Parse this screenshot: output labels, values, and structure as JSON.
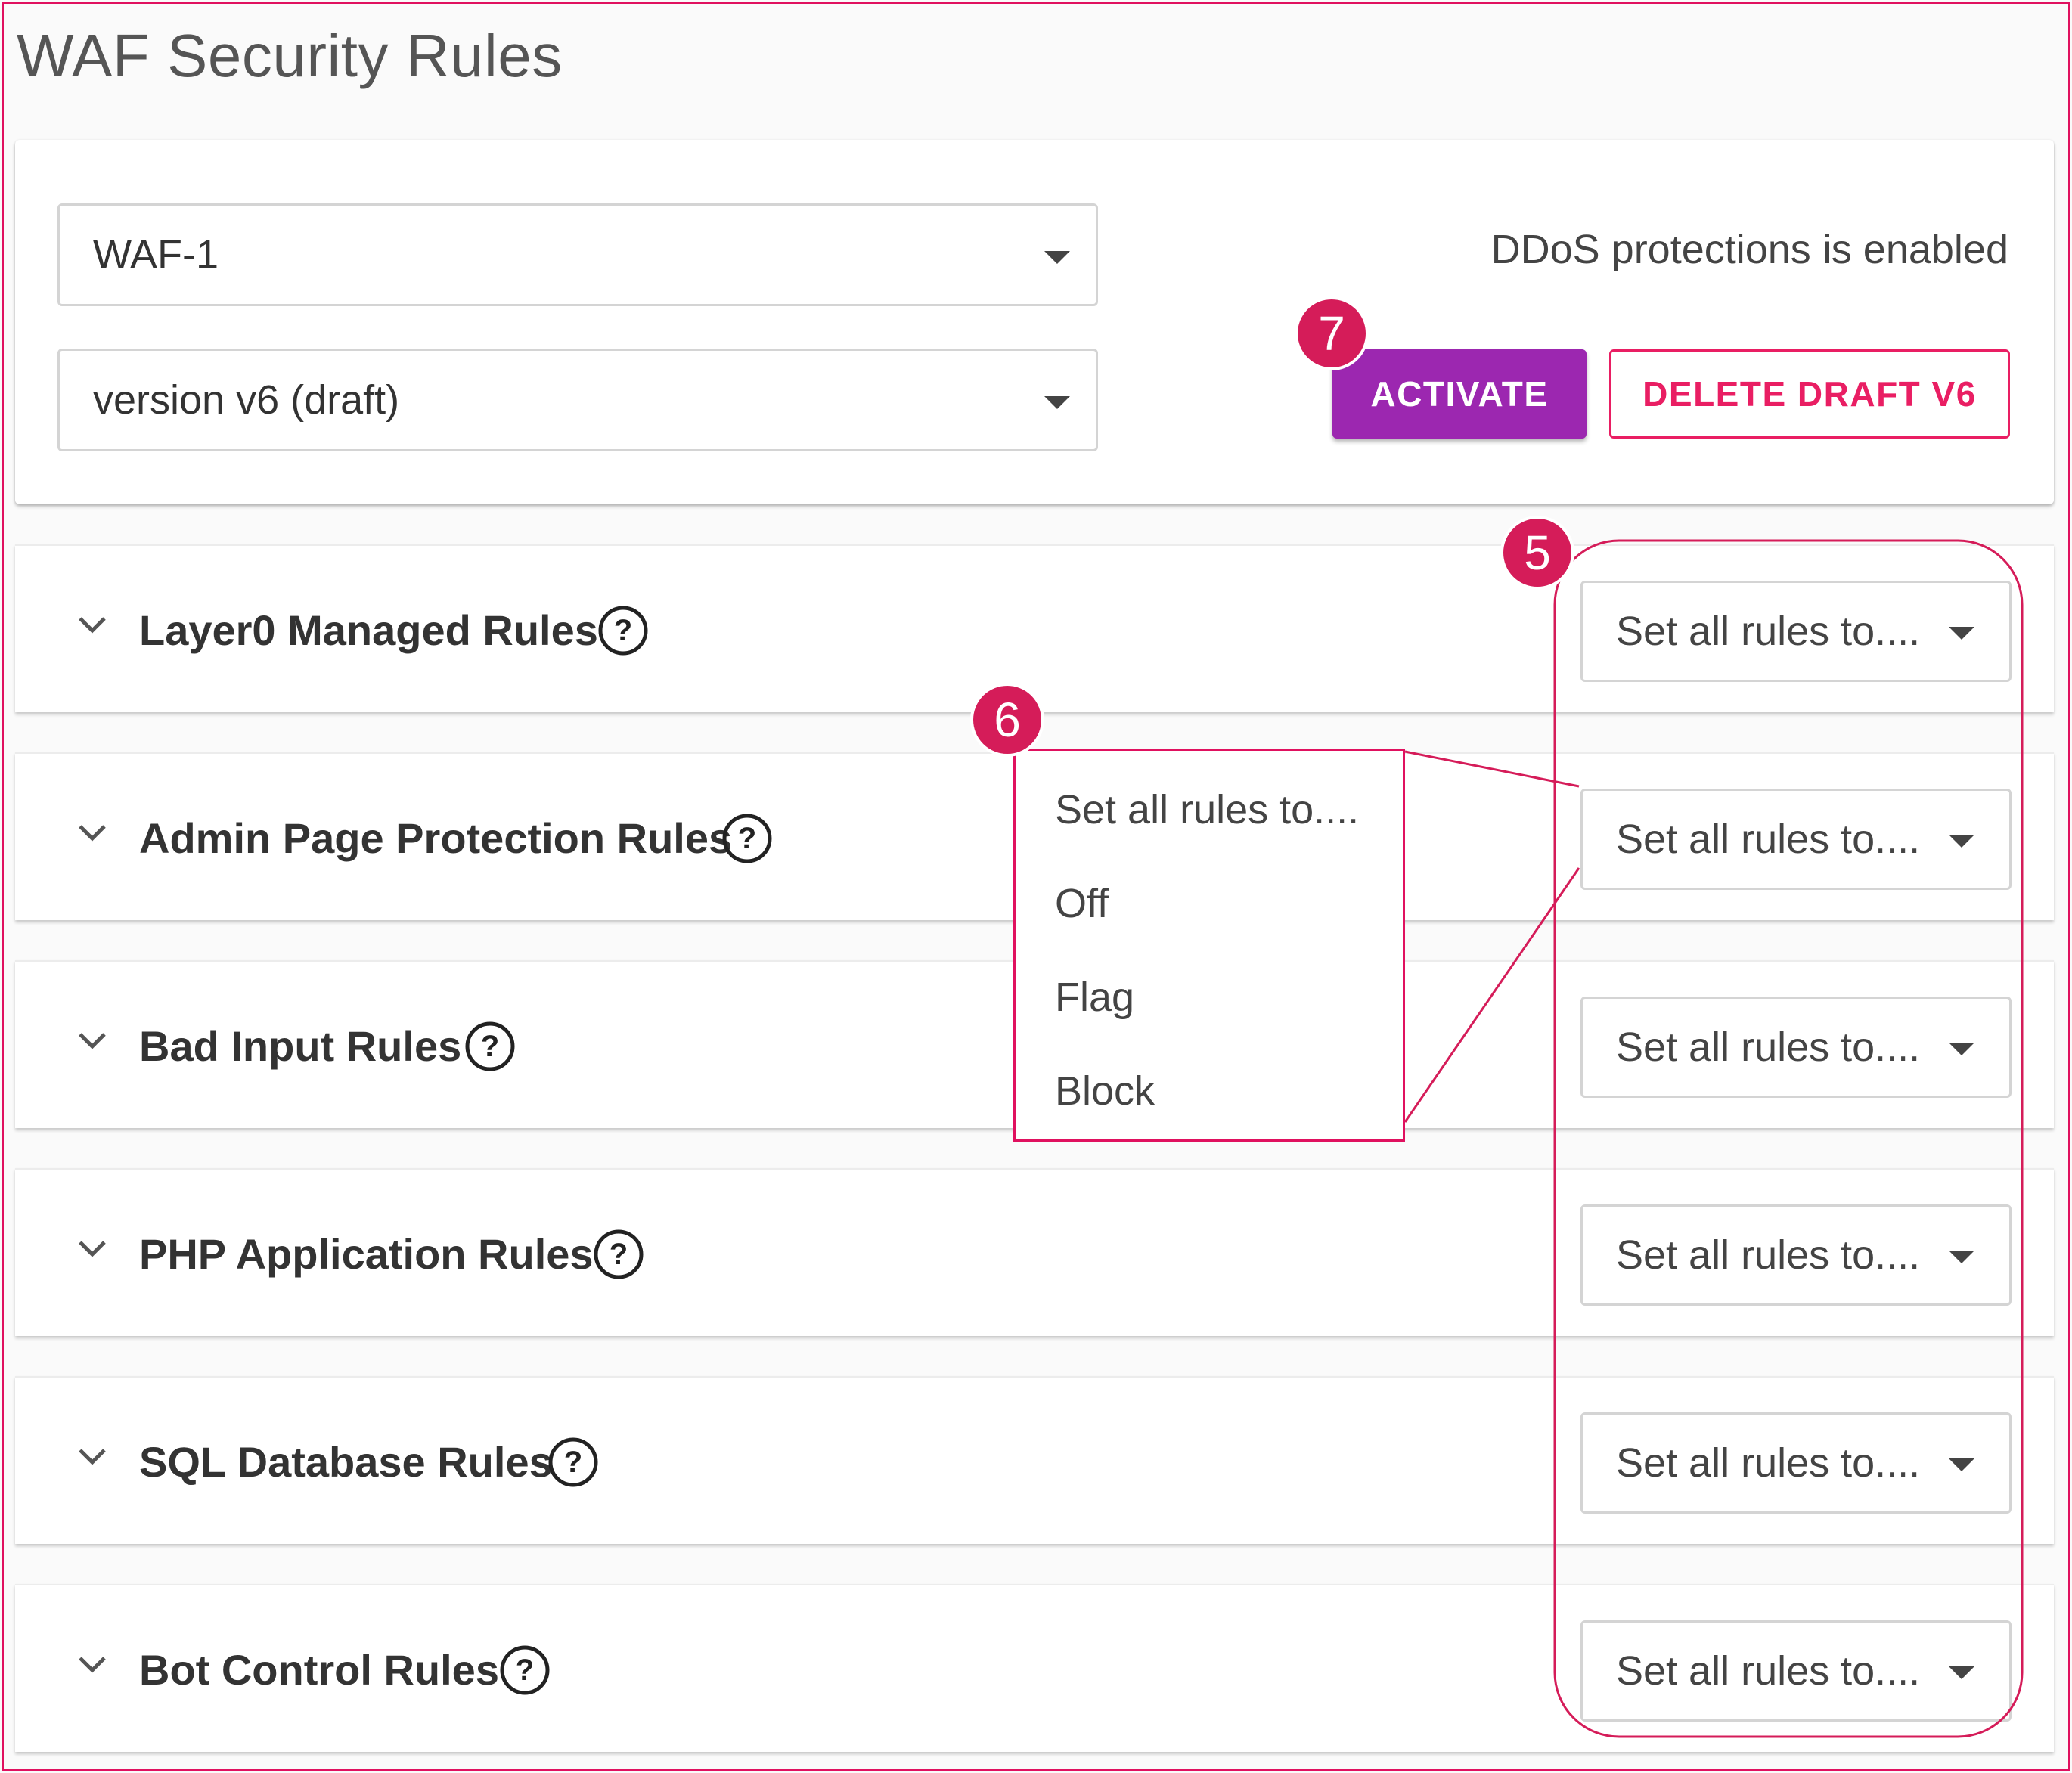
{
  "page": {
    "title": "WAF Security Rules"
  },
  "config": {
    "waf_select": {
      "value": "WAF-1"
    },
    "version_select": {
      "value": "version v6 (draft)"
    },
    "ddos_status": "DDoS protections is enabled",
    "activate_label": "ACTIVATE",
    "delete_label": "DELETE DRAFT V6"
  },
  "rule_groups": [
    {
      "title": "Layer0 Managed Rules",
      "action_select": "Set all rules to...."
    },
    {
      "title": "Admin Page Protection Rules",
      "action_select": "Set all rules to...."
    },
    {
      "title": "Bad Input Rules",
      "action_select": "Set all rules to...."
    },
    {
      "title": "PHP Application Rules",
      "action_select": "Set all rules to...."
    },
    {
      "title": "SQL Database Rules",
      "action_select": "Set all rules to...."
    },
    {
      "title": "Bot Control Rules",
      "action_select": "Set all rules to...."
    }
  ],
  "dropdown_menu": {
    "options": [
      "Set all rules to....",
      "Off",
      "Flag",
      "Block"
    ]
  },
  "callouts": {
    "five": "5",
    "six": "6",
    "seven": "7"
  },
  "colors": {
    "accent_purple": "#9c27b0",
    "delete_pink": "#e91e63",
    "callout": "#d51c59",
    "frame": "#e0115f"
  },
  "icons": {
    "expand": "chevron-down-icon",
    "help": "help-circle-icon",
    "select": "caret-down-icon"
  }
}
